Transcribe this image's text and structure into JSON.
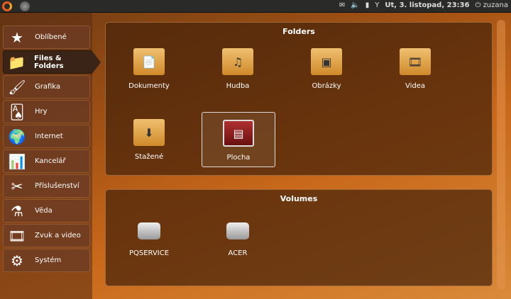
{
  "topbar": {
    "datetime": "Ut,  3. listopad, 23:36",
    "user": "zuzana",
    "icons": [
      "ubuntu-logo-icon",
      "app-icon",
      "mail-icon",
      "volume-icon",
      "battery-icon",
      "network-icon",
      "power-icon"
    ]
  },
  "sidebar": {
    "items": [
      {
        "label": "Oblíbené",
        "icon": "★"
      },
      {
        "label": "Files & Folders",
        "icon": "📁",
        "selected": true
      },
      {
        "label": "Grafika",
        "icon": "🖌"
      },
      {
        "label": "Hry",
        "icon": "🂡"
      },
      {
        "label": "Internet",
        "icon": "🌍"
      },
      {
        "label": "Kancelář",
        "icon": "📊"
      },
      {
        "label": "Příslušenství",
        "icon": "✂"
      },
      {
        "label": "Věda",
        "icon": "⚗"
      },
      {
        "label": "Zvuk a video",
        "icon": "🎞"
      },
      {
        "label": "Systém",
        "icon": "⚙"
      }
    ]
  },
  "folders": {
    "title": "Folders",
    "items": [
      {
        "label": "Dokumenty",
        "icon": "📄"
      },
      {
        "label": "Hudba",
        "icon": "♫"
      },
      {
        "label": "Obrázky",
        "icon": "▣"
      },
      {
        "label": "Videa",
        "icon": "🎞"
      },
      {
        "label": "Stažené",
        "icon": "⬇"
      },
      {
        "label": "Plocha",
        "icon": "▤",
        "selected": true
      }
    ]
  },
  "volumes": {
    "title": "Volumes",
    "items": [
      {
        "label": "PQSERVICE"
      },
      {
        "label": "ACER"
      }
    ]
  }
}
